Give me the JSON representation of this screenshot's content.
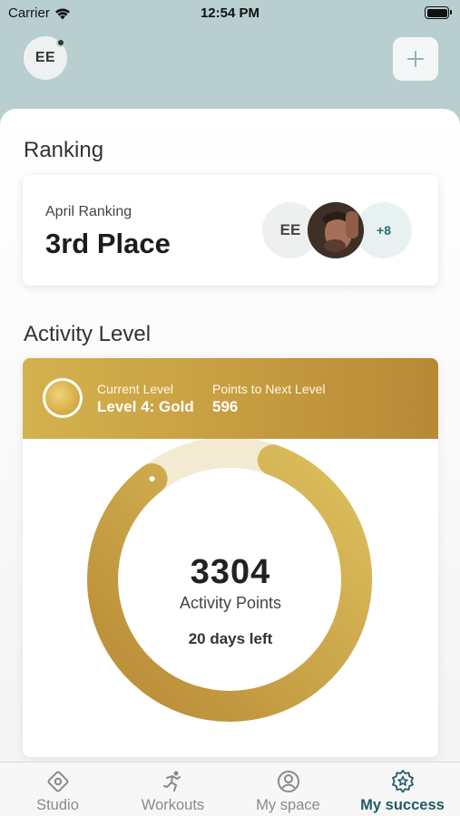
{
  "status_bar": {
    "carrier": "Carrier",
    "time": "12:54 PM"
  },
  "header": {
    "avatar_initials": "EE"
  },
  "ranking": {
    "section_title": "Ranking",
    "label": "April Ranking",
    "value": "3rd Place",
    "avatars": [
      {
        "initials": "EE"
      },
      {
        "initials": ""
      },
      {
        "initials": "+8"
      }
    ]
  },
  "activity": {
    "section_title": "Activity Level",
    "current_level_label": "Current Level",
    "current_level_value": "Level 4: Gold",
    "next_level_label": "Points to Next Level",
    "next_level_value": "596",
    "points": "3304",
    "points_label": "Activity Points",
    "days_left": "20 days left",
    "progress_fraction": 0.84
  },
  "tabs": [
    {
      "label": "Studio",
      "icon": "studio-icon",
      "active": false
    },
    {
      "label": "Workouts",
      "icon": "workouts-icon",
      "active": false
    },
    {
      "label": "My space",
      "icon": "my-space-icon",
      "active": false
    },
    {
      "label": "My success",
      "icon": "my-success-icon",
      "active": true
    }
  ],
  "colors": {
    "header_bg": "#b9cfcf",
    "gold_light": "#d9bc5c",
    "gold_dark": "#b98a35",
    "active_tab": "#1f5c63"
  }
}
